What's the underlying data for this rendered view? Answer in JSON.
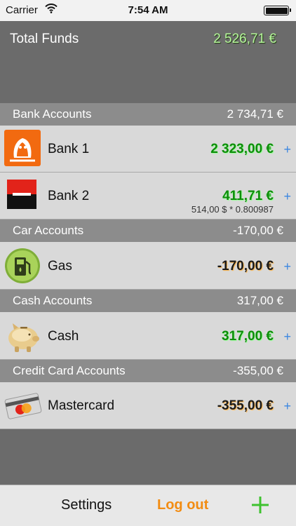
{
  "status_bar": {
    "carrier": "Carrier",
    "time": "7:54 AM"
  },
  "summary": {
    "label": "Total Funds",
    "value": "2 526,71 €"
  },
  "sections": [
    {
      "name": "Bank Accounts",
      "amount": "2 734,71 €",
      "accounts": [
        {
          "name": "Bank 1",
          "amount": "2 323,00 €",
          "icon": "lion-logo-icon"
        },
        {
          "name": "Bank 2",
          "amount": "411,71 €",
          "sub": "514,00 $ * 0.800987",
          "icon": "red-square-logo-icon"
        }
      ]
    },
    {
      "name": "Car Accounts",
      "amount": "-170,00 €",
      "accounts": [
        {
          "name": "Gas",
          "amount": "-170,00 €",
          "icon": "gas-pump-icon"
        }
      ]
    },
    {
      "name": "Cash Accounts",
      "amount": "317,00 €",
      "accounts": [
        {
          "name": "Cash",
          "amount": "317,00 €",
          "icon": "piggy-bank-icon"
        }
      ]
    },
    {
      "name": "Credit Card Accounts",
      "amount": "-355,00 €",
      "accounts": [
        {
          "name": "Mastercard",
          "amount": "-355,00 €",
          "icon": "mastercard-icon"
        }
      ]
    }
  ],
  "add_account_symbol": "+",
  "toolbar": {
    "settings": "Settings",
    "logout": "Log out",
    "add_symbol": "+"
  },
  "colors": {
    "positive": "#0d8d0a",
    "negative_glow": "#ffb547",
    "accent_orange": "#f28c12",
    "plus_blue": "#3b86e0",
    "add_green": "#3ec22f"
  }
}
